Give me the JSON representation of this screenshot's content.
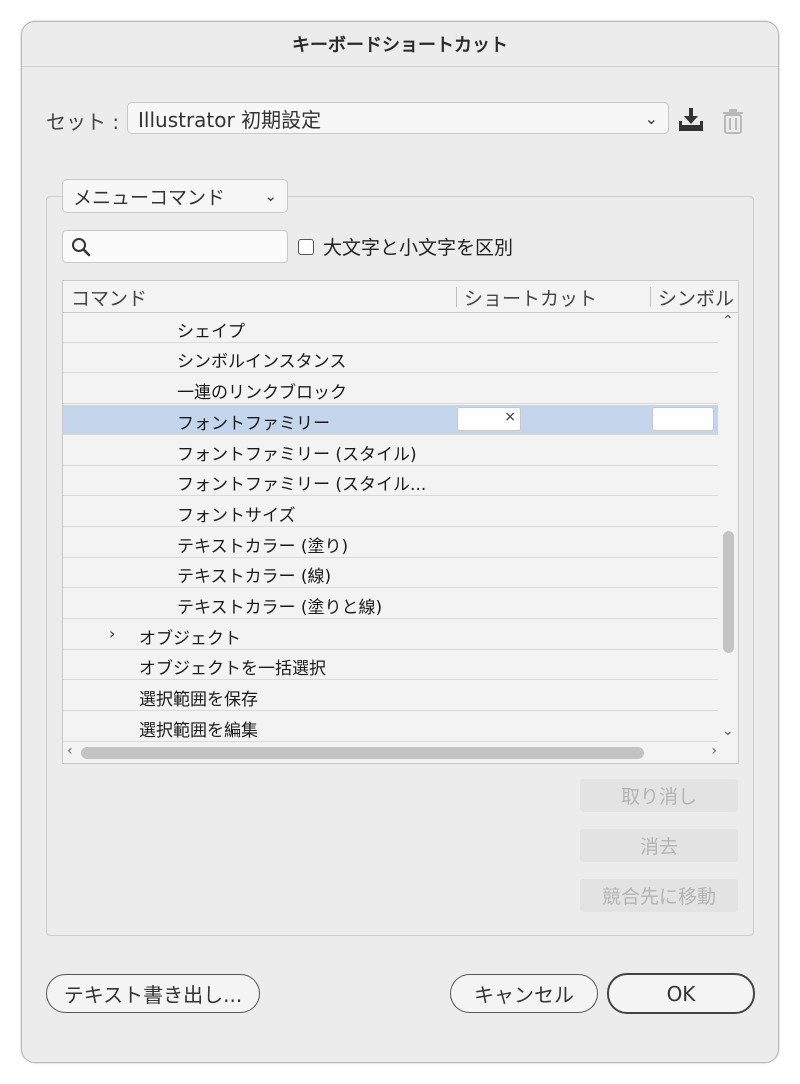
{
  "dialog": {
    "title": "キーボードショートカット"
  },
  "set": {
    "label": "セット :",
    "value": "Illustrator 初期設定"
  },
  "commands": {
    "dropdown_value": "メニューコマンド",
    "search_placeholder": "",
    "case_checkbox_label": "大文字と小文字を区別",
    "case_checked": false
  },
  "table": {
    "columns": [
      "コマンド",
      "ショートカット",
      "シンボル"
    ],
    "rows": [
      {
        "label": "シェイプ"
      },
      {
        "label": "シンボルインスタンス"
      },
      {
        "label": "一連のリンクブロック"
      },
      {
        "label": "フォントファミリー",
        "shortcut_clear": "×"
      },
      {
        "label": "フォントファミリー (スタイル)"
      },
      {
        "label": "フォントファミリー (スタイル..."
      },
      {
        "label": "フォントサイズ"
      },
      {
        "label": "テキストカラー (塗り)"
      },
      {
        "label": "テキストカラー (線)"
      },
      {
        "label": "テキストカラー (塗りと線)"
      },
      {
        "label": "オブジェクト",
        "expander": "›"
      },
      {
        "label": "オブジェクトを一括選択"
      },
      {
        "label": "選択範囲を保存"
      },
      {
        "label": "選択範囲を編集"
      }
    ]
  },
  "side_buttons": {
    "undo": "取り消し",
    "clear": "消去",
    "goto_conflict": "競合先に移動"
  },
  "footer": {
    "export": "テキスト書き出し...",
    "cancel": "キャンセル",
    "ok": "OK"
  },
  "colors": {
    "selection": "#c5d5ec",
    "dialog_bg": "#ececec"
  }
}
